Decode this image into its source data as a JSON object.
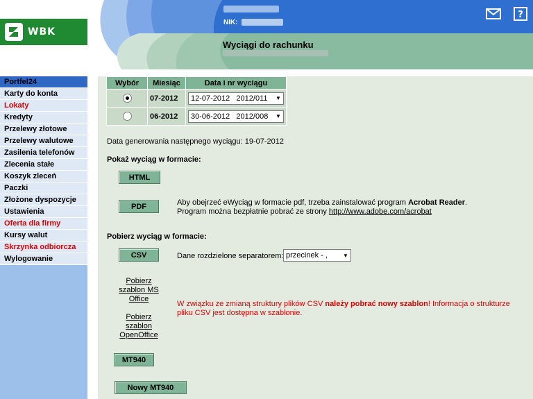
{
  "header": {
    "logo_text": "WBK",
    "nik_label": "NIK:",
    "page_title": "Wyciągi do rachunku",
    "mail_icon": "mail-icon",
    "help_icon": "help-icon"
  },
  "sidebar": {
    "items": [
      {
        "label": "Portfel24",
        "style": "head"
      },
      {
        "label": "Karty do konta",
        "style": "normal"
      },
      {
        "label": "Lokaty",
        "style": "red"
      },
      {
        "label": "Kredyty",
        "style": "normal"
      },
      {
        "label": "Przelewy złotowe",
        "style": "normal"
      },
      {
        "label": "Przelewy walutowe",
        "style": "normal"
      },
      {
        "label": "Zasilenia telefonów",
        "style": "normal"
      },
      {
        "label": "Zlecenia stałe",
        "style": "normal"
      },
      {
        "label": "Koszyk zleceń",
        "style": "normal"
      },
      {
        "label": "Paczki",
        "style": "normal"
      },
      {
        "label": "Złożone dyspozycje",
        "style": "normal"
      },
      {
        "label": "Ustawienia",
        "style": "normal"
      },
      {
        "label": "Oferta dla firmy",
        "style": "red"
      },
      {
        "label": "Kursy walut",
        "style": "normal"
      },
      {
        "label": "Skrzynka odbiorcza",
        "style": "red"
      },
      {
        "label": "Wylogowanie",
        "style": "normal"
      }
    ]
  },
  "table": {
    "headers": [
      "Wybór",
      "Miesiąc",
      "Data i nr wyciągu"
    ],
    "rows": [
      {
        "selected": true,
        "month": "07-2012",
        "statement": "12-07-2012   2012/011"
      },
      {
        "selected": false,
        "month": "06-2012",
        "statement": "30-06-2012   2012/008"
      }
    ]
  },
  "next_date": "Data generowania następnego wyciągu: 19-07-2012",
  "show_section": {
    "heading": "Pokaż wyciąg w formacie:",
    "html_button": "HTML",
    "pdf_button": "PDF",
    "pdf_info_1": "Aby obejrzeć eWyciąg w formacie pdf, trzeba zainstalować program ",
    "pdf_info_app": "Acrobat Reader",
    "pdf_info_2": "Program można bezpłatnie pobrać ze strony ",
    "pdf_link": "http://www.adobe.com/acrobat"
  },
  "download_section": {
    "heading": "Pobierz wyciąg w formacie:",
    "csv_button": "CSV",
    "separator_label": "Dane rozdzielone separatorem:",
    "separator_value": "przecinek - ,",
    "template_ms": [
      "Pobierz",
      "szablon MS",
      "Office"
    ],
    "template_oo": [
      "Pobierz",
      "szablon",
      "OpenOffice"
    ],
    "notice_1": "W związku ze zmianą struktury plików CSV ",
    "notice_bold": "należy pobrać nowy szablon",
    "notice_2": "! Informacja o strukturze",
    "notice_3": "pliku CSV jest dostępna w szablonie.",
    "mt940_button": "MT940",
    "new_mt940_button": "Nowy MT940"
  },
  "colors": {
    "accent_green": "#7fb497",
    "sidebar_blue": "#9dc0ea",
    "logo_green": "#1f8a32",
    "alert_red": "#e30000"
  }
}
